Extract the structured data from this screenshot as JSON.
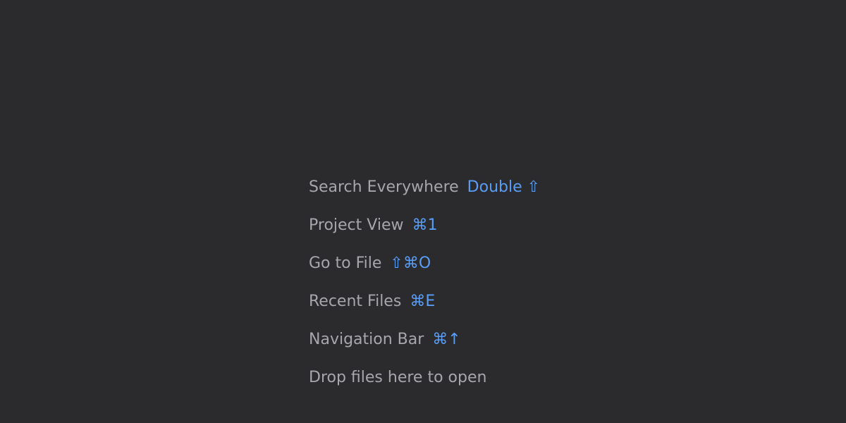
{
  "empty_state": {
    "hints": [
      {
        "label": "Search Everywhere",
        "shortcut": "Double ⇧"
      },
      {
        "label": "Project View",
        "shortcut": "⌘1"
      },
      {
        "label": "Go to File",
        "shortcut": "⇧⌘O"
      },
      {
        "label": "Recent Files",
        "shortcut": "⌘E"
      },
      {
        "label": "Navigation Bar",
        "shortcut": "⌘↑"
      }
    ],
    "drop_text": "Drop files here to open"
  },
  "colors": {
    "background": "#2b2b2e",
    "label": "#a6a6ab",
    "shortcut": "#589df6"
  }
}
